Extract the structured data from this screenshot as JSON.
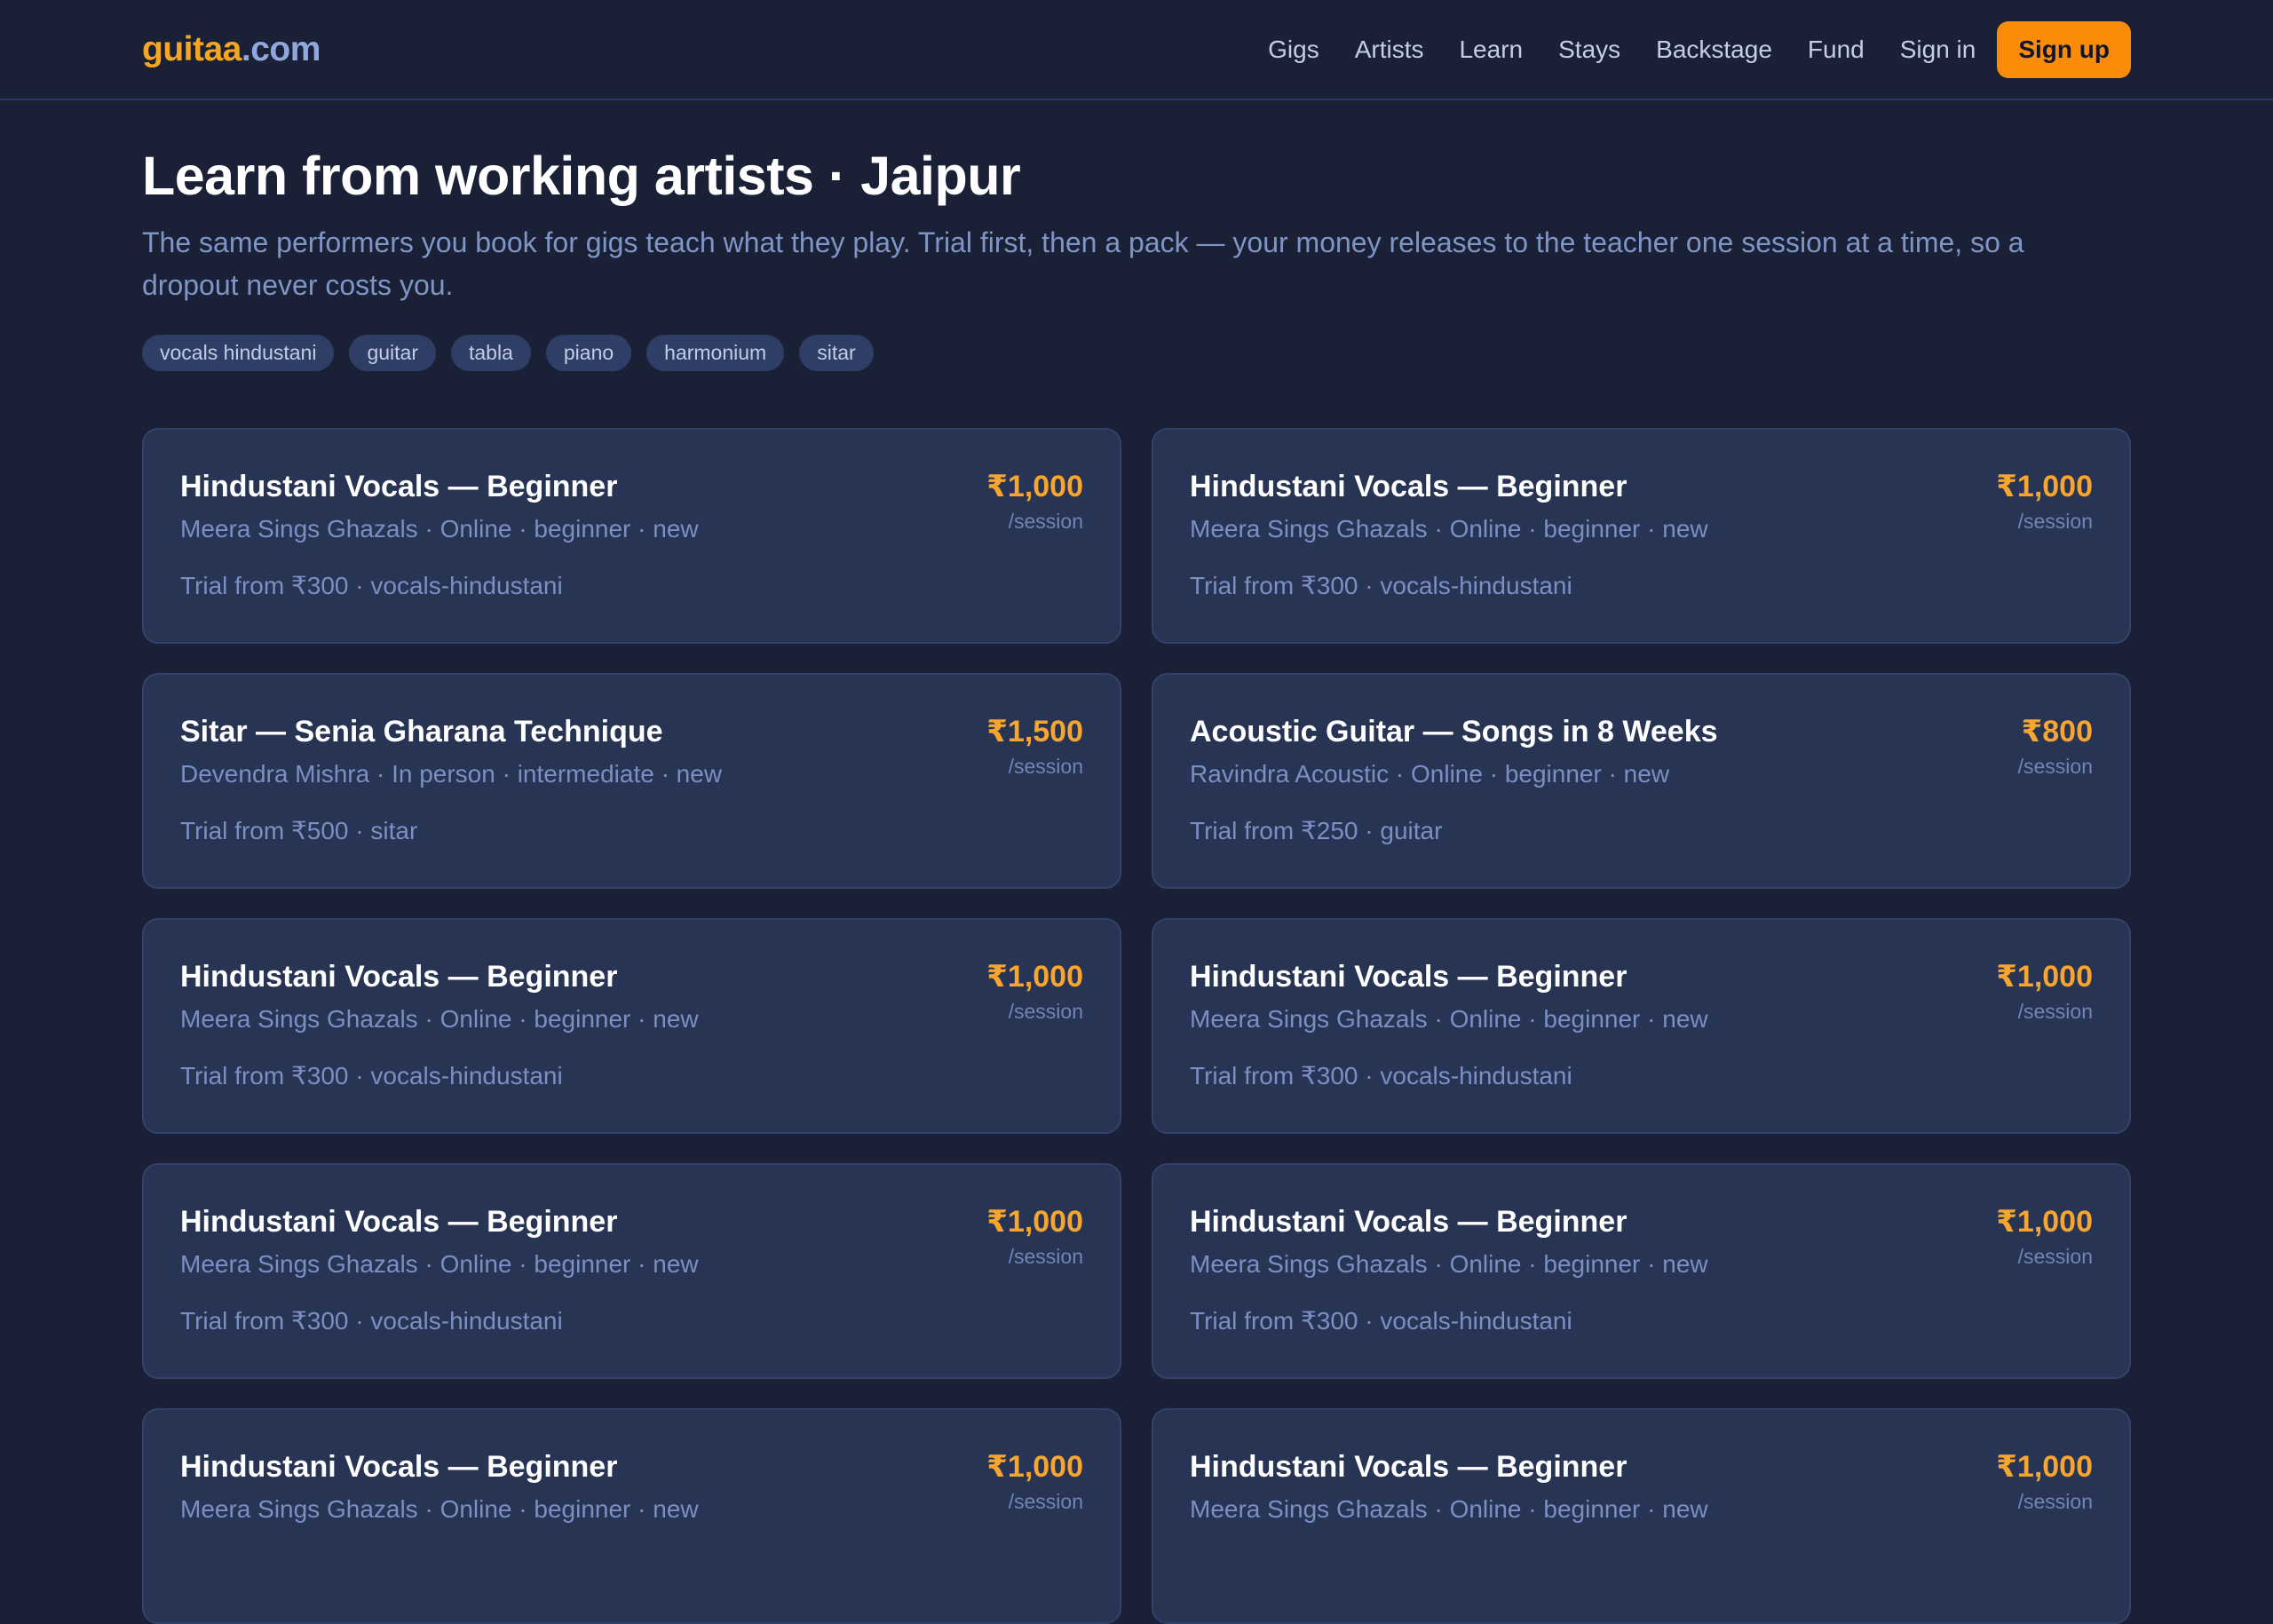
{
  "header": {
    "logo_brand": "guitaa",
    "logo_tld": ".com",
    "nav": [
      "Gigs",
      "Artists",
      "Learn",
      "Stays",
      "Backstage",
      "Fund",
      "Sign in"
    ],
    "signup_label": "Sign up"
  },
  "page": {
    "title": "Learn from working artists · Jaipur",
    "subtitle": "The same performers you book for gigs teach what they play. Trial first, then a pack — your money releases to the teacher one session at a time, so a dropout never costs you."
  },
  "tags": [
    "vocals hindustani",
    "guitar",
    "tabla",
    "piano",
    "harmonium",
    "sitar"
  ],
  "cards": [
    {
      "title": "Hindustani Vocals — Beginner",
      "meta": "Meera Sings Ghazals · Online · beginner · new",
      "trial": "Trial from ₹300 · vocals-hindustani",
      "price": "₹1,000",
      "unit": "/session"
    },
    {
      "title": "Hindustani Vocals — Beginner",
      "meta": "Meera Sings Ghazals · Online · beginner · new",
      "trial": "Trial from ₹300 · vocals-hindustani",
      "price": "₹1,000",
      "unit": "/session"
    },
    {
      "title": "Sitar — Senia Gharana Technique",
      "meta": "Devendra Mishra · In person · intermediate · new",
      "trial": "Trial from ₹500 · sitar",
      "price": "₹1,500",
      "unit": "/session"
    },
    {
      "title": "Acoustic Guitar — Songs in 8 Weeks",
      "meta": "Ravindra Acoustic · Online · beginner · new",
      "trial": "Trial from ₹250 · guitar",
      "price": "₹800",
      "unit": "/session"
    },
    {
      "title": "Hindustani Vocals — Beginner",
      "meta": "Meera Sings Ghazals · Online · beginner · new",
      "trial": "Trial from ₹300 · vocals-hindustani",
      "price": "₹1,000",
      "unit": "/session"
    },
    {
      "title": "Hindustani Vocals — Beginner",
      "meta": "Meera Sings Ghazals · Online · beginner · new",
      "trial": "Trial from ₹300 · vocals-hindustani",
      "price": "₹1,000",
      "unit": "/session"
    },
    {
      "title": "Hindustani Vocals — Beginner",
      "meta": "Meera Sings Ghazals · Online · beginner · new",
      "trial": "Trial from ₹300 · vocals-hindustani",
      "price": "₹1,000",
      "unit": "/session"
    },
    {
      "title": "Hindustani Vocals — Beginner",
      "meta": "Meera Sings Ghazals · Online · beginner · new",
      "trial": "Trial from ₹300 · vocals-hindustani",
      "price": "₹1,000",
      "unit": "/session"
    },
    {
      "title": "Hindustani Vocals — Beginner",
      "meta": "Meera Sings Ghazals · Online · beginner · new",
      "trial": "",
      "price": "₹1,000",
      "unit": "/session"
    },
    {
      "title": "Hindustani Vocals — Beginner",
      "meta": "Meera Sings Ghazals · Online · beginner · new",
      "trial": "",
      "price": "₹1,000",
      "unit": "/session"
    }
  ],
  "colors": {
    "background": "#1a2035",
    "card": "#283453",
    "accent": "#fb8c0a",
    "price": "#f7a531",
    "muted": "#7b8fc4"
  }
}
